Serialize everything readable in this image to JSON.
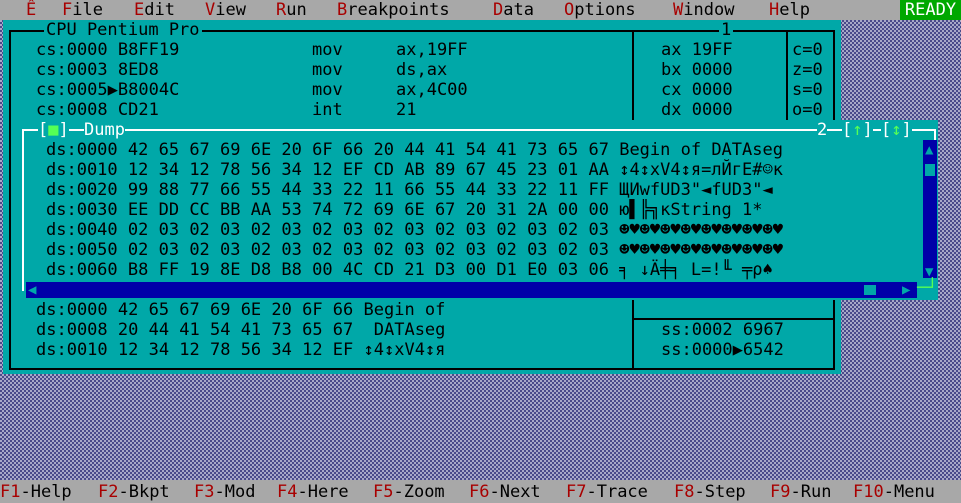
{
  "menu": {
    "system": "Ê",
    "items": [
      {
        "hot": "F",
        "rest": "ile"
      },
      {
        "hot": "E",
        "rest": "dit"
      },
      {
        "hot": "V",
        "rest": "iew"
      },
      {
        "hot": "R",
        "rest": "un"
      },
      {
        "hot": "B",
        "rest": "reakpoints"
      },
      {
        "hot": "D",
        "rest": "ata"
      },
      {
        "hot": "O",
        "rest": "ptions"
      },
      {
        "hot": "W",
        "rest": "indow"
      },
      {
        "hot": "H",
        "rest": "elp"
      }
    ],
    "status": "READY"
  },
  "cpu": {
    "title": "CPU Pentium Pro",
    "window_number": "1",
    "code": [
      {
        "addr": "cs:0000",
        "bytes": "B8FF19",
        "mnem": "mov",
        "ops": "ax,19FF"
      },
      {
        "addr": "cs:0003",
        "bytes": "8ED8",
        "mnem": "mov",
        "ops": "ds,ax"
      },
      {
        "addr": "cs:0005▶",
        "bytes": "B8004C",
        "mnem": "mov",
        "ops": "ax,4C00"
      },
      {
        "addr": "cs:0008",
        "bytes": "CD21",
        "mnem": "int",
        "ops": "21"
      }
    ],
    "registers": [
      "ax 19FF",
      "bx 0000",
      "cx 0000",
      "dx 0000"
    ],
    "flags": [
      "c=0",
      "z=0",
      "s=0",
      "o=0"
    ],
    "data_pane": [
      "ds:0000 42 65 67 69 6E 20 6F 66 Begin of",
      "ds:0008 20 44 41 54 41 73 65 67  DATAseg",
      "ds:0010 12 34 12 78 56 34 12 EF ↕4↕xV4↕я"
    ],
    "stack_pane": [
      "ss:0002 6967",
      "ss:0000▶6542"
    ]
  },
  "dump": {
    "title": "Dump",
    "window_number": "2",
    "close_glyph": "■",
    "up_glyph": "↑",
    "updown_glyph": "↕",
    "rows": [
      {
        "addr": "ds:0000",
        "hex": "42 65 67 69 6E 20 6F 66 20 44 41 54 41 73 65 67",
        "ascii": "Begin of DATAseg"
      },
      {
        "addr": "ds:0010",
        "hex": "12 34 12 78 56 34 12 EF CD AB 89 67 45 23 01 AA",
        "ascii": "↕4↕xV4↕я=лЙгE#☺к"
      },
      {
        "addr": "ds:0020",
        "hex": "99 88 77 66 55 44 33 22 11 66 55 44 33 22 11 FF",
        "ascii": "ЩИwfUD3\"◄fUD3\"◄"
      },
      {
        "addr": "ds:0030",
        "hex": "EE DD CC BB AA 53 74 72 69 6E 67 20 31 2A 00 00",
        "ascii": "ю▌╠╗кString 1*"
      },
      {
        "addr": "ds:0040",
        "hex": "02 03 02 03 02 03 02 03 02 03 02 03 02 03 02 03",
        "ascii": "☻♥☻♥☻♥☻♥☻♥☻♥☻♥☻♥"
      },
      {
        "addr": "ds:0050",
        "hex": "02 03 02 03 02 03 02 03 02 03 02 03 02 03 02 03",
        "ascii": "☻♥☻♥☻♥☻♥☻♥☻♥☻♥☻♥"
      },
      {
        "addr": "ds:0060",
        "hex": "B8 FF 19 8E D8 B8 00 4C CD 21 D3 00 D1 E0 03 06",
        "ascii": "╕ ↓Ä╪╕ L=!╙ ╤ρ♠"
      }
    ]
  },
  "function_keys": [
    {
      "key": "F1",
      "label": "-Help"
    },
    {
      "key": "F2",
      "label": "-Bkpt"
    },
    {
      "key": "F3",
      "label": "-Mod"
    },
    {
      "key": "F4",
      "label": "-Here"
    },
    {
      "key": "F5",
      "label": "-Zoom"
    },
    {
      "key": "F6",
      "label": "-Next"
    },
    {
      "key": "F7",
      "label": "-Trace"
    },
    {
      "key": "F8",
      "label": "-Step"
    },
    {
      "key": "F9",
      "label": "-Run"
    },
    {
      "key": "F10",
      "label": "-Menu"
    }
  ],
  "colors": {
    "desktop": "#4a4a8a",
    "window": "#00a8a8",
    "menu": "#a8a8a8",
    "hotkey": "#a80000",
    "ready": "#00a800",
    "scrollbar": "#0000a8"
  }
}
